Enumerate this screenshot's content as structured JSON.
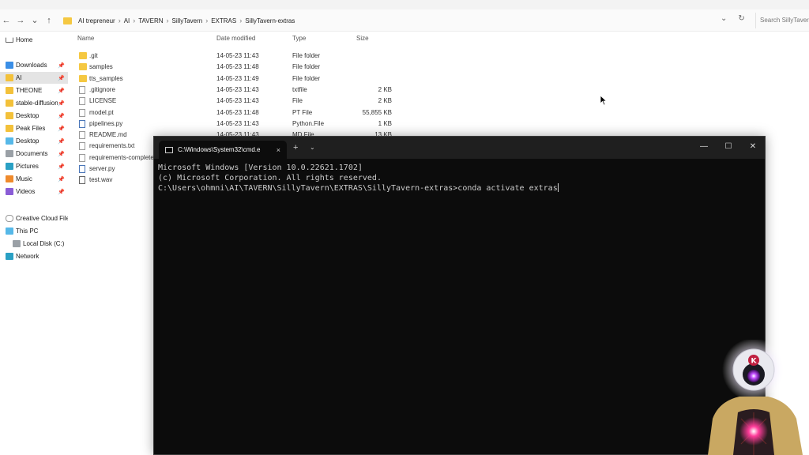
{
  "explorer": {
    "nav": {
      "back": "←",
      "forward": "→",
      "dropdown": "⌄",
      "up": "↑"
    },
    "breadcrumb": [
      "AI trepreneur",
      "AI",
      "TAVERN",
      "SillyTavern",
      "EXTRAS",
      "SillyTavern-extras"
    ],
    "search_placeholder": "Search SillyTavern",
    "columns": {
      "name": "Name",
      "date": "Date modified",
      "type": "Type",
      "size": "Size"
    },
    "sidebar": [
      {
        "label": "Home",
        "icon": "home-icon"
      },
      {
        "label": "Downloads",
        "icon": "download-icon",
        "pinned": true
      },
      {
        "label": "AI",
        "icon": "folder-icon",
        "pinned": true,
        "selected": true
      },
      {
        "label": "THEONE",
        "icon": "folder-icon",
        "pinned": true
      },
      {
        "label": "stable-diffusion",
        "icon": "folder-icon",
        "pinned": true
      },
      {
        "label": "Desktop",
        "icon": "folder-icon",
        "pinned": true
      },
      {
        "label": "Peak Files",
        "icon": "folder-icon",
        "pinned": true
      },
      {
        "label": "Desktop",
        "icon": "desktop-icon",
        "pinned": true
      },
      {
        "label": "Documents",
        "icon": "documents-icon",
        "pinned": true
      },
      {
        "label": "Pictures",
        "icon": "pictures-icon",
        "pinned": true
      },
      {
        "label": "Music",
        "icon": "music-icon",
        "pinned": true
      },
      {
        "label": "Videos",
        "icon": "videos-icon",
        "pinned": true
      },
      {
        "label": "Creative Cloud Files",
        "icon": "cloud-icon"
      },
      {
        "label": "This PC",
        "icon": "pc-icon"
      },
      {
        "label": "Local Disk (C:)",
        "icon": "disk-icon"
      },
      {
        "label": "Network",
        "icon": "network-icon"
      }
    ],
    "files": [
      {
        "name": ".git",
        "date": "14-05-23 11:43",
        "type": "File folder",
        "size": "",
        "kind": "folder"
      },
      {
        "name": "samples",
        "date": "14-05-23 11:48",
        "type": "File folder",
        "size": "",
        "kind": "folder"
      },
      {
        "name": "tts_samples",
        "date": "14-05-23 11:49",
        "type": "File folder",
        "size": "",
        "kind": "folder"
      },
      {
        "name": ".gitignore",
        "date": "14-05-23 11:43",
        "type": "txtfile",
        "size": "2 KB",
        "kind": "doc"
      },
      {
        "name": "LICENSE",
        "date": "14-05-23 11:43",
        "type": "File",
        "size": "2 KB",
        "kind": "doc"
      },
      {
        "name": "model.pt",
        "date": "14-05-23 11:48",
        "type": "PT File",
        "size": "55,855 KB",
        "kind": "doc"
      },
      {
        "name": "pipelines.py",
        "date": "14-05-23 11:43",
        "type": "Python.File",
        "size": "1 KB",
        "kind": "py"
      },
      {
        "name": "README.md",
        "date": "14-05-23 11:43",
        "type": "MD File",
        "size": "13 KB",
        "kind": "doc"
      },
      {
        "name": "requirements.txt",
        "date": "",
        "type": "",
        "size": "",
        "kind": "doc"
      },
      {
        "name": "requirements-complete",
        "date": "",
        "type": "",
        "size": "",
        "kind": "doc"
      },
      {
        "name": "server.py",
        "date": "",
        "type": "",
        "size": "",
        "kind": "py"
      },
      {
        "name": "test.wav",
        "date": "",
        "type": "",
        "size": "",
        "kind": "wav"
      }
    ]
  },
  "cmd": {
    "tab_title": "C:\\Windows\\System32\\cmd.e",
    "tab_close": "×",
    "new_tab": "+",
    "tab_dropdown": "⌄",
    "minimize": "—",
    "maximize": "☐",
    "close": "✕",
    "lines": [
      "Microsoft Windows [Version 10.0.22621.1702]",
      "(c) Microsoft Corporation. All rights reserved.",
      "",
      "C:\\Users\\ohmni\\AI\\TAVERN\\SillyTavern\\EXTRAS\\SillyTavern-extras>conda activate extras"
    ]
  },
  "avatar": {
    "badge_letter": "K"
  },
  "colors": {
    "cmd_bg": "#0c0c0c",
    "cmd_text": "#cccccc",
    "selected": "#e4e4e4",
    "folder": "#f5c842"
  }
}
